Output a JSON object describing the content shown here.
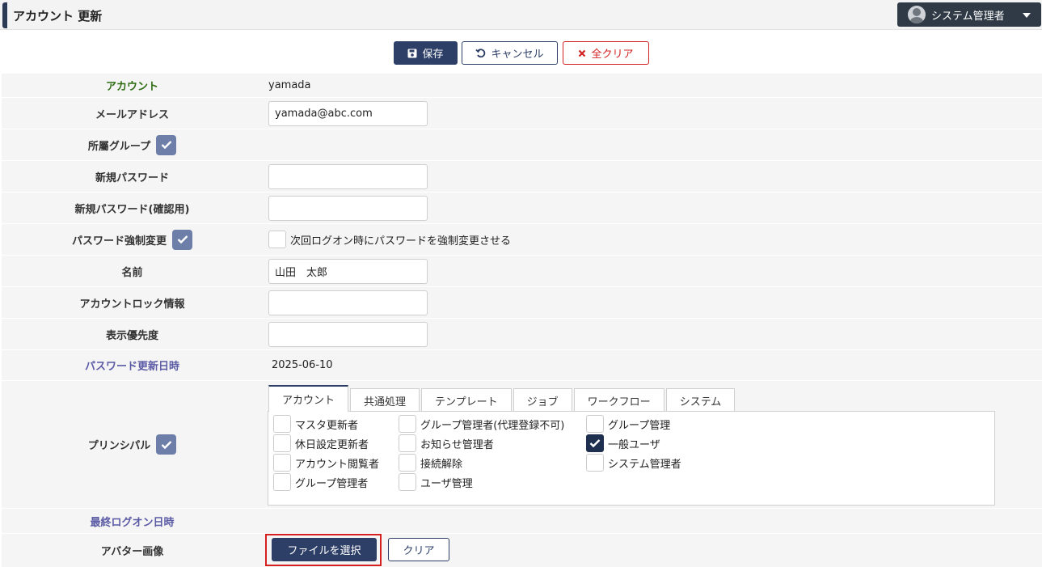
{
  "header": {
    "title": "アカウント 更新",
    "user_label": "システム管理者"
  },
  "toolbar": {
    "save_label": "保存",
    "cancel_label": "キャンセル",
    "clear_all_label": "全クリア"
  },
  "form": {
    "account_label": "アカウント",
    "account_value": "yamada",
    "email_label": "メールアドレス",
    "email_value": "yamada@abc.com",
    "group_label": "所屬グループ",
    "new_password_label": "新規パスワード",
    "new_password_confirm_label": "新規パスワード(確認用)",
    "force_change_label": "パスワード強制変更",
    "force_change_option": "次回ログオン時にパスワードを強制変更させる",
    "name_label": "名前",
    "name_value": "山田　太郎",
    "lock_label": "アカウントロック情報",
    "lock_value": "",
    "priority_label": "表示優先度",
    "priority_value": "",
    "pw_updated_label": "パスワード更新日時",
    "pw_updated_value": "2025-06-10",
    "principal_label": "プリンシパル",
    "last_logon_label": "最終ログオン日時",
    "avatar_label": "アバター画像",
    "choose_file_label": "ファイルを選択",
    "clear_label": "クリア"
  },
  "principal_tabs": [
    "アカウント",
    "共通処理",
    "テンプレート",
    "ジョブ",
    "ワークフロー",
    "システム"
  ],
  "permissions": [
    {
      "label": "マスタ更新者",
      "checked": false
    },
    {
      "label": "休日設定更新者",
      "checked": false
    },
    {
      "label": "アカウント閲覧者",
      "checked": false
    },
    {
      "label": "グループ管理者",
      "checked": false
    },
    {
      "label": "グループ管理者(代理登録不可)",
      "checked": false
    },
    {
      "label": "お知らせ管理者",
      "checked": false
    },
    {
      "label": "接続解除",
      "checked": false
    },
    {
      "label": "ユーザ管理",
      "checked": false
    },
    {
      "label": "グループ管理",
      "checked": false
    },
    {
      "label": "一般ユーザ",
      "checked": true
    },
    {
      "label": "システム管理者",
      "checked": false
    }
  ],
  "colors": {
    "primary": "#2d3f67",
    "danger": "#d32020",
    "badge": "#6d7fa8",
    "label_green": "#2e6b12",
    "label_purple": "#5b5ba6"
  }
}
